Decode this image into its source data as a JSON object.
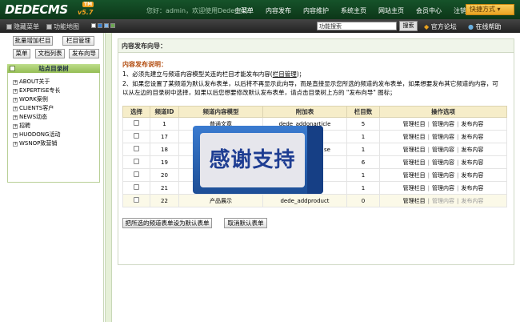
{
  "header": {
    "logo": "DEDECMS",
    "badge": "TM",
    "version": "v5.7",
    "welcome": "您好：admin，欢迎使用DedeCMS！",
    "nav": [
      "主菜单",
      "内容发布",
      "内容维护",
      "系统主页",
      "网站主页",
      "会员中心",
      "注销"
    ],
    "shortcut": "快捷方式 ▾"
  },
  "subbar": {
    "hide_menu": "隐藏菜单",
    "site_map": "功能地图",
    "search_value": "功能搜索",
    "search_button": "搜索",
    "forum": "官方论坛",
    "help": "在线帮助"
  },
  "sidebar": {
    "buttons": [
      "批量增加栏目",
      "栏目管理",
      "菜单",
      "文档列表",
      "发布向导"
    ],
    "tree_title": "站点目录树",
    "nodes": [
      "ABOUT关于",
      "EXPERTISE专长",
      "WORK案例",
      "CLIENTS客户",
      "NEWS动态",
      "招聘",
      "HUODONG活动",
      "WSNOP致营销"
    ]
  },
  "main": {
    "title": "内容发布向导：",
    "desc_title": "内容发布说明：",
    "desc1_pre": "1、必须先建立与频道内容模型关连的栏目才能发布内容(",
    "desc1_link": "栏目管理",
    "desc1_post": ")；",
    "desc2a": "2、如果您设置了某频道为默认发布表单，以后将不再显示此向导，而是直接显示您所选的频道的发布表单，如果想要发布其它频道的内容，可",
    "desc2b": "以从左边的目录树中选择，如果以后您想要修改默认发布表单，请点击目录树上方的 \"发布向导\" 图标；",
    "columns": [
      "选择",
      "频道ID",
      "频道内容模型",
      "附加表",
      "栏目数",
      "操作选项"
    ],
    "rows": [
      {
        "id": "1",
        "model": "普通文章",
        "table": "dede_addonarticle",
        "count": "5",
        "op1": "管理栏目",
        "op2": "管理内容",
        "op3": "发布内容"
      },
      {
        "id": "17",
        "model": "",
        "table": "",
        "count": "1",
        "op1": "管理栏目",
        "op2": "管理内容",
        "op3": "发布内容"
      },
      {
        "id": "18",
        "model": "",
        "table": "se",
        "count": "1",
        "op1": "管理栏目",
        "op2": "管理内容",
        "op3": "发布内容"
      },
      {
        "id": "19",
        "model": "",
        "table": "",
        "count": "6",
        "op1": "管理栏目",
        "op2": "管理内容",
        "op3": "发布内容"
      },
      {
        "id": "20",
        "model": "",
        "table": "",
        "count": "1",
        "op1": "管理栏目",
        "op2": "管理内容",
        "op3": "发布内容"
      },
      {
        "id": "21",
        "model": "",
        "table": "",
        "count": "1",
        "op1": "管理栏目",
        "op2": "管理内容",
        "op3": "发布内容"
      },
      {
        "id": "22",
        "model": "产品展示",
        "table": "dede_addproduct",
        "count": "0",
        "op1": "管理栏目",
        "op2": "管理内容",
        "op3": "发布内容"
      }
    ],
    "set_default_button": "把所选的频道表单设为默认表单",
    "cancel_default_button": "取消默认表单"
  },
  "watermark": {
    "text": "感谢支持"
  }
}
